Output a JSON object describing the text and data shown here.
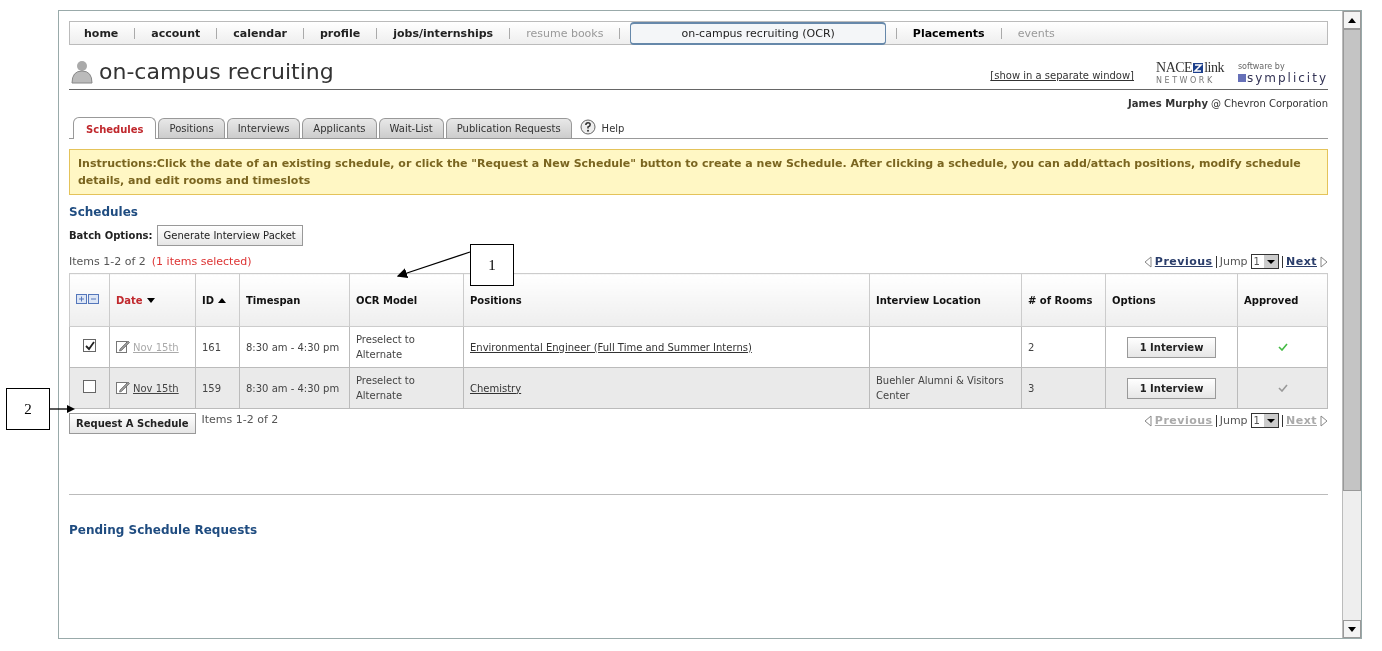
{
  "nav": [
    {
      "label": "home",
      "selected": false,
      "disabled": false,
      "emphasized": false
    },
    {
      "label": "account",
      "selected": false,
      "disabled": false,
      "emphasized": false
    },
    {
      "label": "calendar",
      "selected": false,
      "disabled": false,
      "emphasized": false
    },
    {
      "label": "profile",
      "selected": false,
      "disabled": false,
      "emphasized": false
    },
    {
      "label": "jobs/internships",
      "selected": false,
      "disabled": false,
      "emphasized": false
    },
    {
      "label": "resume books",
      "selected": false,
      "disabled": true,
      "emphasized": false
    },
    {
      "label": "on-campus recruiting (OCR)",
      "selected": true,
      "disabled": false,
      "emphasized": false
    },
    {
      "label": "Placements",
      "selected": false,
      "disabled": false,
      "emphasized": true
    },
    {
      "label": "events",
      "selected": false,
      "disabled": true,
      "emphasized": false
    }
  ],
  "title": "on-campus recruiting",
  "separate_window_link": "[show in a separate window]",
  "logos": {
    "nace": "NACE",
    "link": "link",
    "network": "N E T W O R K",
    "software_by": "software by",
    "symplicity": "symplicity"
  },
  "user": {
    "name": "James Murphy",
    "at": "@",
    "company": "Chevron Corporation"
  },
  "tabs": [
    {
      "label": "Schedules",
      "selected": true
    },
    {
      "label": "Positions",
      "selected": false
    },
    {
      "label": "Interviews",
      "selected": false
    },
    {
      "label": "Applicants",
      "selected": false
    },
    {
      "label": "Wait-List",
      "selected": false
    },
    {
      "label": "Publication Requests",
      "selected": false
    }
  ],
  "help": "Help",
  "instructions": "Instructions:Click the date of an existing schedule, or click the \"Request a New Schedule\" button to create a new Schedule. After clicking a schedule, you can add/attach positions, modify schedule details, and edit rooms and timeslots",
  "section_title": "Schedules",
  "batch": {
    "label": "Batch Options:",
    "button": "Generate Interview Packet"
  },
  "items_count": "Items 1-2 of 2",
  "selected_count": "(1 items selected)",
  "pager_top": {
    "previous": "Previous",
    "jump": "Jump",
    "page": "1",
    "next": "Next",
    "disabled": false
  },
  "table": {
    "columns": [
      {
        "label": "Date",
        "selected": true,
        "sort_ascending": false
      },
      {
        "label": "ID",
        "selected": false,
        "sort_ascending": true
      },
      {
        "label": "Timespan",
        "selected": false
      },
      {
        "label": "OCR Model",
        "selected": false
      },
      {
        "label": "Positions",
        "selected": false
      },
      {
        "label": "Interview Location",
        "selected": false
      },
      {
        "label": "# of Rooms",
        "selected": false
      },
      {
        "label": "Options",
        "selected": false
      },
      {
        "label": "Approved",
        "selected": false
      }
    ],
    "rows": [
      {
        "checked": true,
        "date": "Nov 15th",
        "date_greyed": true,
        "id": "161",
        "timespan": "8:30 am - 4:30 pm",
        "ocr_model": "Preselect to Alternate",
        "positions": "Environmental Engineer (Full Time and Summer Interns)",
        "rooms": "2",
        "option": "1 Interview",
        "color": "#44bb44"
      },
      {
        "checked": false,
        "date": "Nov 15th",
        "date_greyed": false,
        "id": "159",
        "timespan": "8:30 am - 4:30 pm",
        "ocr_model": "Preselect to Alternate",
        "positions": "Chemistry",
        "location": "Buehler Alumni & Visitors Center",
        "rooms": "3",
        "option": "1 Interview",
        "color": "#999999"
      }
    ]
  },
  "request_button": "Request A Schedule",
  "items_count_bottom": "Items 1-2 of 2",
  "pager_bottom": {
    "previous": "Previous",
    "jump": "Jump",
    "page": "1",
    "next": "Next",
    "disabled": true
  },
  "pending_title": "Pending Schedule Requests",
  "callouts": [
    {
      "label": "1"
    },
    {
      "label": "2"
    }
  ]
}
